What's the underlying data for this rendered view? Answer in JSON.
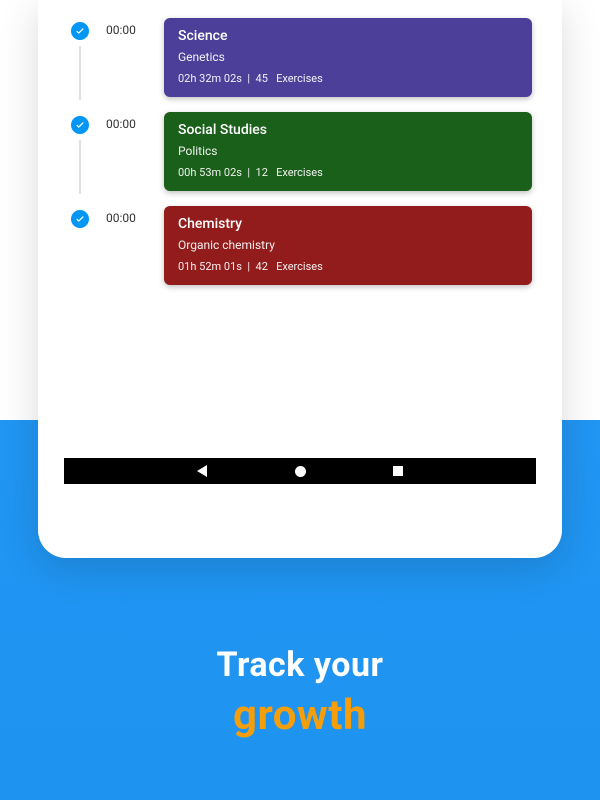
{
  "entries": [
    {
      "time": "00:00",
      "subject": "Science",
      "topic": "Genetics",
      "duration": "02h 32m 02s",
      "count": "45",
      "unit": "Exercises",
      "color": "#4c3f99"
    },
    {
      "time": "00:00",
      "subject": "Social Studies",
      "topic": "Politics",
      "duration": "00h 53m 02s",
      "count": "12",
      "unit": "Exercises",
      "color": "#1a5f1a"
    },
    {
      "time": "00:00",
      "subject": "Chemistry",
      "topic": "Organic chemistry",
      "duration": "01h 52m 01s",
      "count": "42",
      "unit": "Exercises",
      "color": "#921c1c"
    }
  ],
  "caption": {
    "line1": "Track your",
    "line2": "growth"
  }
}
